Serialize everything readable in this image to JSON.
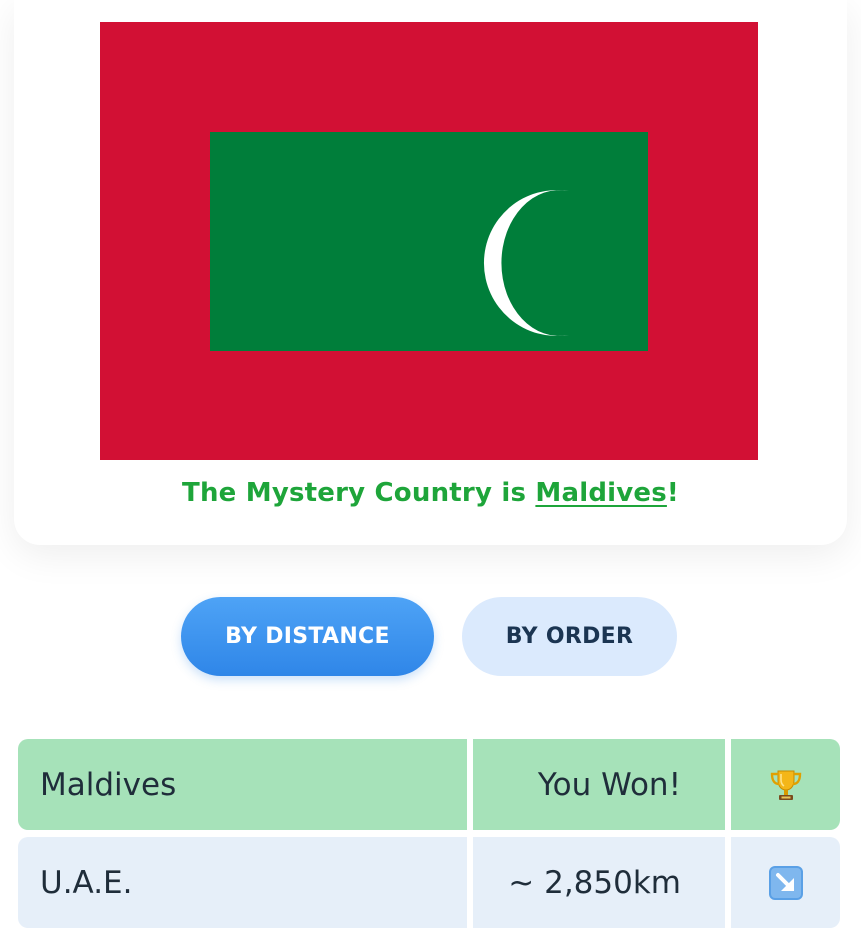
{
  "flag": {
    "name": "Maldives",
    "colors": {
      "outer": "#d21034",
      "inner": "#007e3a",
      "crescent": "#ffffff"
    }
  },
  "result": {
    "prefix": "The Mystery Country is ",
    "country": "Maldives",
    "suffix": "!"
  },
  "sort_tabs": [
    {
      "label": "BY DISTANCE",
      "active": true
    },
    {
      "label": "BY ORDER",
      "active": false
    }
  ],
  "guesses": [
    {
      "country": "Maldives",
      "distance": "You Won!",
      "icon": "trophy-icon"
    },
    {
      "country": "U.A.E.",
      "distance": "~ 2,850km",
      "icon": "arrow-down-right-icon"
    }
  ],
  "accent_colors": {
    "win": "#1ea53a",
    "win_row": "#a6e2b9",
    "guess_row": "#e6eff9",
    "active_tab": "#2f86e8",
    "inactive_tab": "#dbeafd"
  }
}
